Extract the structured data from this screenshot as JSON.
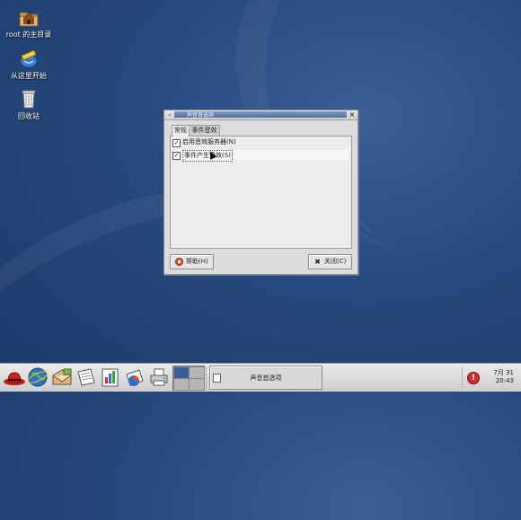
{
  "desktop": {
    "icons": [
      {
        "label": "root 的主目录",
        "icon": "home-folder-icon"
      },
      {
        "label": "从这里开始",
        "icon": "start-here-icon"
      },
      {
        "label": "回收站",
        "icon": "trash-icon"
      }
    ]
  },
  "dialog": {
    "title": "声音首选项",
    "tabs": [
      {
        "label": "常规",
        "active": true
      },
      {
        "label": "事件音效",
        "active": false
      }
    ],
    "options": [
      {
        "label": "启用音效服务器(N)",
        "checked": true
      },
      {
        "label": "事件产生音效(S)",
        "checked": true
      }
    ],
    "help_button": "帮助(H)",
    "close_button": "关闭(C)"
  },
  "panel": {
    "launchers": [
      "redhat-menu-icon",
      "web-browser-icon",
      "email-icon",
      "writer-icon",
      "impress-icon",
      "calc-icon",
      "print-manager-icon"
    ],
    "task_button": "声音首选项",
    "clock_date": "7月 31",
    "clock_time": "20:43",
    "alert_symbol": "!"
  }
}
